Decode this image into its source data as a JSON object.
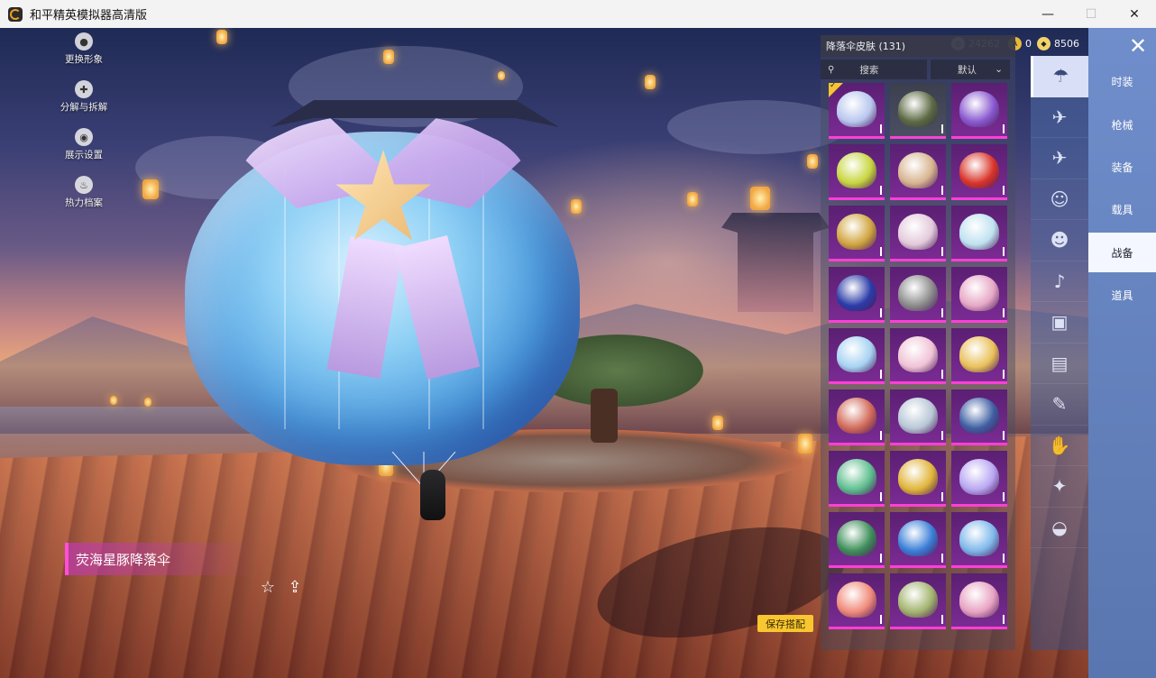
{
  "window": {
    "title": "和平精英模拟器高清版",
    "minimize": "—",
    "maximize": "☐",
    "close": "✕"
  },
  "currency": [
    {
      "icon": "silver-coin-icon",
      "value": "24262",
      "color": "#cfd3da"
    },
    {
      "icon": "gold-badge-icon",
      "value": "0",
      "color": "#e8b93b"
    },
    {
      "icon": "gold-coin-icon",
      "value": "8506",
      "color": "#f1d36a"
    }
  ],
  "left_menu": [
    {
      "icon": "person-icon",
      "label": "更换形象"
    },
    {
      "icon": "puzzle-icon",
      "label": "分解与拆解"
    },
    {
      "icon": "eye-icon",
      "label": "展示设置"
    },
    {
      "icon": "flame-icon",
      "label": "热力档案"
    }
  ],
  "item": {
    "name": "荧海星豚降落伞"
  },
  "panel": {
    "title": "降落伞皮肤 (131)",
    "search_placeholder": "搜索",
    "sort_label": "默认",
    "tiles": [
      {
        "color": "#b9c7ef",
        "selected": true,
        "rarity": "purple"
      },
      {
        "color": "#5d6a44",
        "selected": false,
        "rarity": "plain"
      },
      {
        "color": "#8a5ad0",
        "selected": false,
        "rarity": "purple"
      },
      {
        "color": "#c8d640",
        "selected": false,
        "rarity": "purple"
      },
      {
        "color": "#d8b490",
        "selected": false,
        "rarity": "purple"
      },
      {
        "color": "#d9352a",
        "selected": false,
        "rarity": "purple"
      },
      {
        "color": "#d1a640",
        "selected": false,
        "rarity": "purple"
      },
      {
        "color": "#e3cadb",
        "selected": false,
        "rarity": "purple"
      },
      {
        "color": "#bfe2f0",
        "selected": false,
        "rarity": "purple"
      },
      {
        "color": "#2c3ca8",
        "selected": false,
        "rarity": "purple"
      },
      {
        "color": "#8c8c8c",
        "selected": false,
        "rarity": "purple"
      },
      {
        "color": "#e7a8c6",
        "selected": false,
        "rarity": "purple"
      },
      {
        "color": "#a7d3f2",
        "selected": false,
        "rarity": "purple"
      },
      {
        "color": "#f0c3d6",
        "selected": false,
        "rarity": "purple"
      },
      {
        "color": "#e9c15a",
        "selected": false,
        "rarity": "purple"
      },
      {
        "color": "#d26b5a",
        "selected": false,
        "rarity": "purple"
      },
      {
        "color": "#b8c7d6",
        "selected": false,
        "rarity": "purple"
      },
      {
        "color": "#3f5fa3",
        "selected": false,
        "rarity": "purple"
      },
      {
        "color": "#5fbf8f",
        "selected": false,
        "rarity": "purple"
      },
      {
        "color": "#e0b53a",
        "selected": false,
        "rarity": "purple"
      },
      {
        "color": "#b9a7f2",
        "selected": false,
        "rarity": "purple"
      },
      {
        "color": "#3e8f5a",
        "selected": false,
        "rarity": "purple"
      },
      {
        "color": "#3b7fd8",
        "selected": false,
        "rarity": "purple"
      },
      {
        "color": "#7fb8ea",
        "selected": false,
        "rarity": "purple"
      },
      {
        "color": "#f08a7a",
        "selected": false,
        "rarity": "purple"
      },
      {
        "color": "#a3b46e",
        "selected": false,
        "rarity": "purple"
      },
      {
        "color": "#e8a2c2",
        "selected": false,
        "rarity": "purple"
      }
    ]
  },
  "save_button": "保存搭配",
  "categories": [
    {
      "icon": "parachute-icon",
      "glyph": "☂"
    },
    {
      "icon": "glider-icon",
      "glyph": "✈"
    },
    {
      "icon": "plane-icon",
      "glyph": "✈"
    },
    {
      "icon": "emote-face-icon",
      "glyph": "☺"
    },
    {
      "icon": "robot-pet-icon",
      "glyph": "☻"
    },
    {
      "icon": "speaker-icon",
      "glyph": "♪"
    },
    {
      "icon": "sticker-icon",
      "glyph": "▣"
    },
    {
      "icon": "picture-icon",
      "glyph": "▤"
    },
    {
      "icon": "spray-icon",
      "glyph": "✎"
    },
    {
      "icon": "hand-gesture-icon",
      "glyph": "✋"
    },
    {
      "icon": "sparkle-wand-icon",
      "glyph": "✦"
    },
    {
      "icon": "ufo-icon",
      "glyph": "◒"
    }
  ],
  "tabs": [
    "时装",
    "枪械",
    "装备",
    "载具",
    "战备",
    "道具"
  ],
  "active_tab": "战备",
  "close_game": "✕"
}
